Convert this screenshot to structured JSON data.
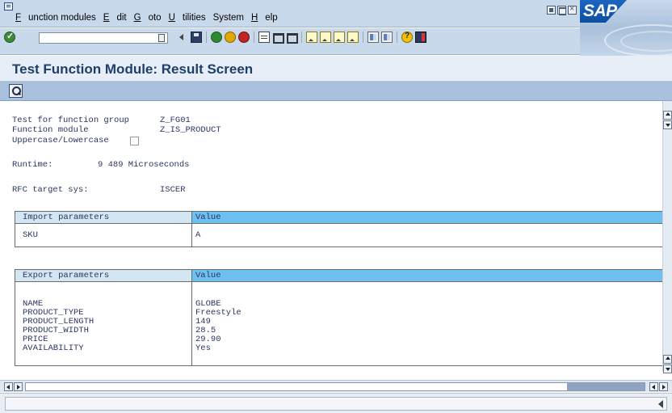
{
  "menu": {
    "items": [
      "Function modules",
      "Edit",
      "Goto",
      "Utilities",
      "System",
      "Help"
    ],
    "underline": [
      "F",
      "E",
      "G",
      "U",
      "S",
      "H"
    ]
  },
  "logo": {
    "text": "SAP"
  },
  "title": {
    "text": "Test Function Module: Result Screen"
  },
  "info": {
    "group_label": "Test for function group",
    "group_value": "Z_FG01",
    "module_label": "Function module",
    "module_value": "Z_IS_PRODUCT",
    "case_label": "Uppercase/Lowercase",
    "runtime_label": "Runtime:",
    "runtime_value": "9 489 Microseconds",
    "rfc_label": "RFC target sys:",
    "rfc_value": "ISCER"
  },
  "import_table": {
    "header_param": "Import parameters",
    "header_value": "Value",
    "rows": [
      {
        "name": "SKU",
        "value": "A"
      }
    ]
  },
  "export_table": {
    "header_param": "Export parameters",
    "header_value": "Value",
    "rows": [
      {
        "name": "NAME",
        "value": "GLOBE"
      },
      {
        "name": "PRODUCT_TYPE",
        "value": "Freestyle"
      },
      {
        "name": "PRODUCT_LENGTH",
        "value": "149"
      },
      {
        "name": "PRODUCT_WIDTH",
        "value": "28.5"
      },
      {
        "name": "PRICE",
        "value": "29.90"
      },
      {
        "name": "AVAILABILITY",
        "value": "Yes"
      }
    ]
  },
  "colors": {
    "header_value_bg": "#6ec0f0",
    "header_param_bg": "#d2e6f3",
    "title_text": "#1f3f6a",
    "app_toolbar": "#a9c1de"
  },
  "icons": {
    "toolbar": [
      "enter-icon",
      "back-icon",
      "save-icon",
      "green-back-icon",
      "exit-icon",
      "cancel-icon",
      "print-icon",
      "find-icon",
      "find-next-icon",
      "first-page-icon",
      "previous-page-icon",
      "next-page-icon",
      "last-page-icon",
      "create-session-icon",
      "shortcut-icon",
      "help-icon",
      "layout-menu-icon"
    ],
    "app_toolbar": [
      "details-icon"
    ]
  }
}
